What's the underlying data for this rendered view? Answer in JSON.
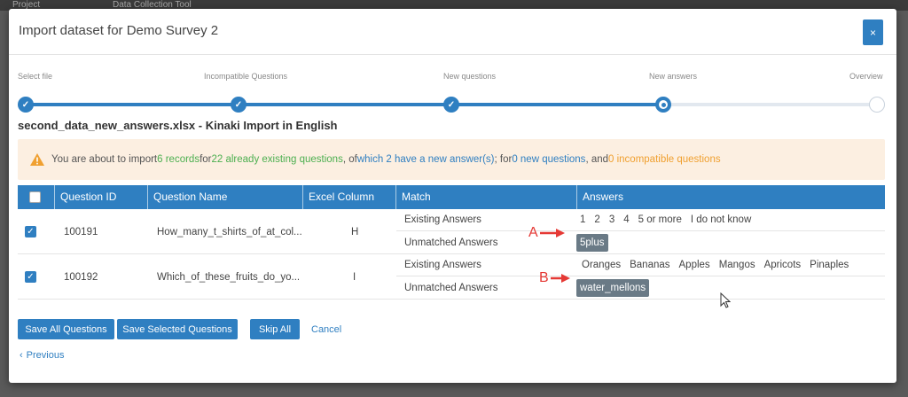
{
  "background": {
    "project_label": "Project",
    "tool_label": "Data Collection Tool"
  },
  "modal": {
    "title": "Import dataset for Demo Survey 2",
    "close_label": "×"
  },
  "steps": [
    {
      "label": "Select file",
      "status": "done"
    },
    {
      "label": "Incompatible Questions",
      "status": "done"
    },
    {
      "label": "New questions",
      "status": "done"
    },
    {
      "label": "New answers",
      "status": "current"
    },
    {
      "label": "Overview",
      "status": "todo"
    }
  ],
  "file_heading": "second_data_new_answers.xlsx - Kinaki Import in English",
  "alert": {
    "p1": "You are about to import ",
    "records": "6 records",
    "p2": " for ",
    "existing": "22 already existing questions",
    "p3": " , of ",
    "new_answers": "which 2 have a new answer(s)",
    "p4": " ; for ",
    "new_questions": "0 new questions",
    "p5": " , and ",
    "incompatible": "0 incompatible questions"
  },
  "table": {
    "headers": {
      "question_id": "Question ID",
      "question_name": "Question Name",
      "excel_column": "Excel Column",
      "match": "Match",
      "answers": "Answers"
    },
    "rows": [
      {
        "checked": true,
        "question_id": "100191",
        "question_name": "How_many_t_shirts_of_at_col...",
        "excel_column": "H",
        "existing_label": "Existing Answers",
        "existing_answers": [
          "1",
          "2",
          "3",
          "4",
          "5 or more",
          "I do not know"
        ],
        "unmatched_label": "Unmatched Answers",
        "unmatched_answer": "5plus",
        "annotation": "A"
      },
      {
        "checked": true,
        "question_id": "100192",
        "question_name": "Which_of_these_fruits_do_yo...",
        "excel_column": "I",
        "existing_label": "Existing Answers",
        "existing_answers": [
          "Oranges",
          "Bananas",
          "Apples",
          "Mangos",
          "Apricots",
          "Pinaples"
        ],
        "unmatched_label": "Unmatched Answers",
        "unmatched_answer": "water_mellons",
        "annotation": "B"
      }
    ]
  },
  "buttons": {
    "save_all": "Save All Questions",
    "save_selected": "Save Selected Questions",
    "skip_all": "Skip All",
    "cancel": "Cancel",
    "previous": "Previous"
  },
  "colors": {
    "primary": "#2f7fc1",
    "alert_bg": "#fcefe1",
    "green": "#4caf50",
    "orange": "#f0a030",
    "tag_bg": "#6a7a86",
    "annotation": "#e53935"
  }
}
